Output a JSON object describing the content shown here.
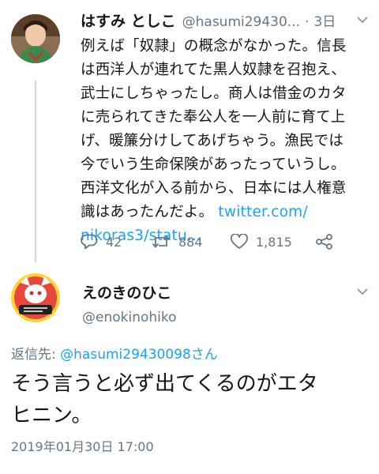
{
  "tweet1": {
    "name": "はすみ としこ",
    "handle": "@hasumi29430...",
    "separator": "·",
    "time": "3日",
    "body_lines": [
      "例えば「奴隷」の概念がなかった。信長",
      "は西洋人が連れてた黒人奴隷を召抱え、",
      "武士にしちゃったし。商人は借金のカタ",
      "に売られてきた奉公人を一人前に育て上",
      "げ、暖簾分けしてあげちゃう。漁民では",
      "今でいう生命保険があったっていうし。",
      "西洋文化が入る前から、日本には人権意"
    ],
    "body_last_text": "識はあったんだよ。",
    "link_part1": "twitter.com/",
    "link_part2": "nikoras3/statu...",
    "actions": {
      "replies": "42",
      "retweets": "884",
      "likes": "1,815"
    }
  },
  "tweet2": {
    "name": "えのきのひこ",
    "handle": "@enokinohiko",
    "reply_label": "返信先:",
    "reply_to": "@hasumi29430098さん",
    "body_lines": [
      "そう言うと必ず出てくるのがエタ",
      "ヒニン。"
    ],
    "timestamp": "2019年01月30日 17:00"
  },
  "icons": {
    "reply": "reply-icon",
    "retweet": "retweet-icon",
    "like": "heart-icon",
    "share": "share-icon",
    "caret": "chevron-down-icon"
  },
  "colors": {
    "link": "#1da1f2",
    "secondary_text": "#657786",
    "primary_text": "#14171a",
    "thread_line": "#ccd6dd"
  }
}
